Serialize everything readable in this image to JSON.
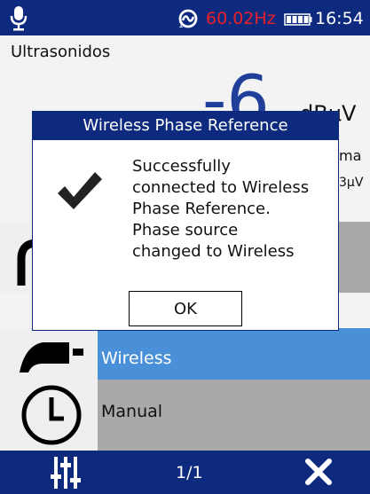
{
  "status_bar": {
    "mic_icon": "microphone-icon",
    "phase_icon": "phase-sync-icon",
    "phase_sub": "1",
    "frequency": "60.02Hz",
    "frequency_color": "#e8202a",
    "battery_icon": "battery-icon",
    "time": "16:54"
  },
  "background": {
    "mode_label": "Ultrasonidos",
    "big_value": "-6",
    "unit": "dBμV",
    "sub1": "ma",
    "sub2": "3μV",
    "accent_color": "#1f3f9a"
  },
  "phase_options": [
    {
      "label": "",
      "icon": "plug-icon"
    },
    {
      "label": "Wireless",
      "icon": "wireless-plug-icon",
      "selected": true
    },
    {
      "label": "Manual",
      "icon": "clock-icon"
    }
  ],
  "dialog": {
    "title": "Wireless Phase Reference",
    "icon": "checkmark-icon",
    "message": "Successfully\nconnected to Wireless\nPhase Reference.\nPhase source\nchanged to Wireless",
    "ok_label": "OK"
  },
  "bottom_bar": {
    "settings_icon": "sliders-icon",
    "page": "1/1",
    "close_icon": "close-icon"
  },
  "colors": {
    "header_bg": "#0d2a7e",
    "selected_row": "#4a90d9",
    "row_grey": "#a9a9a9"
  }
}
